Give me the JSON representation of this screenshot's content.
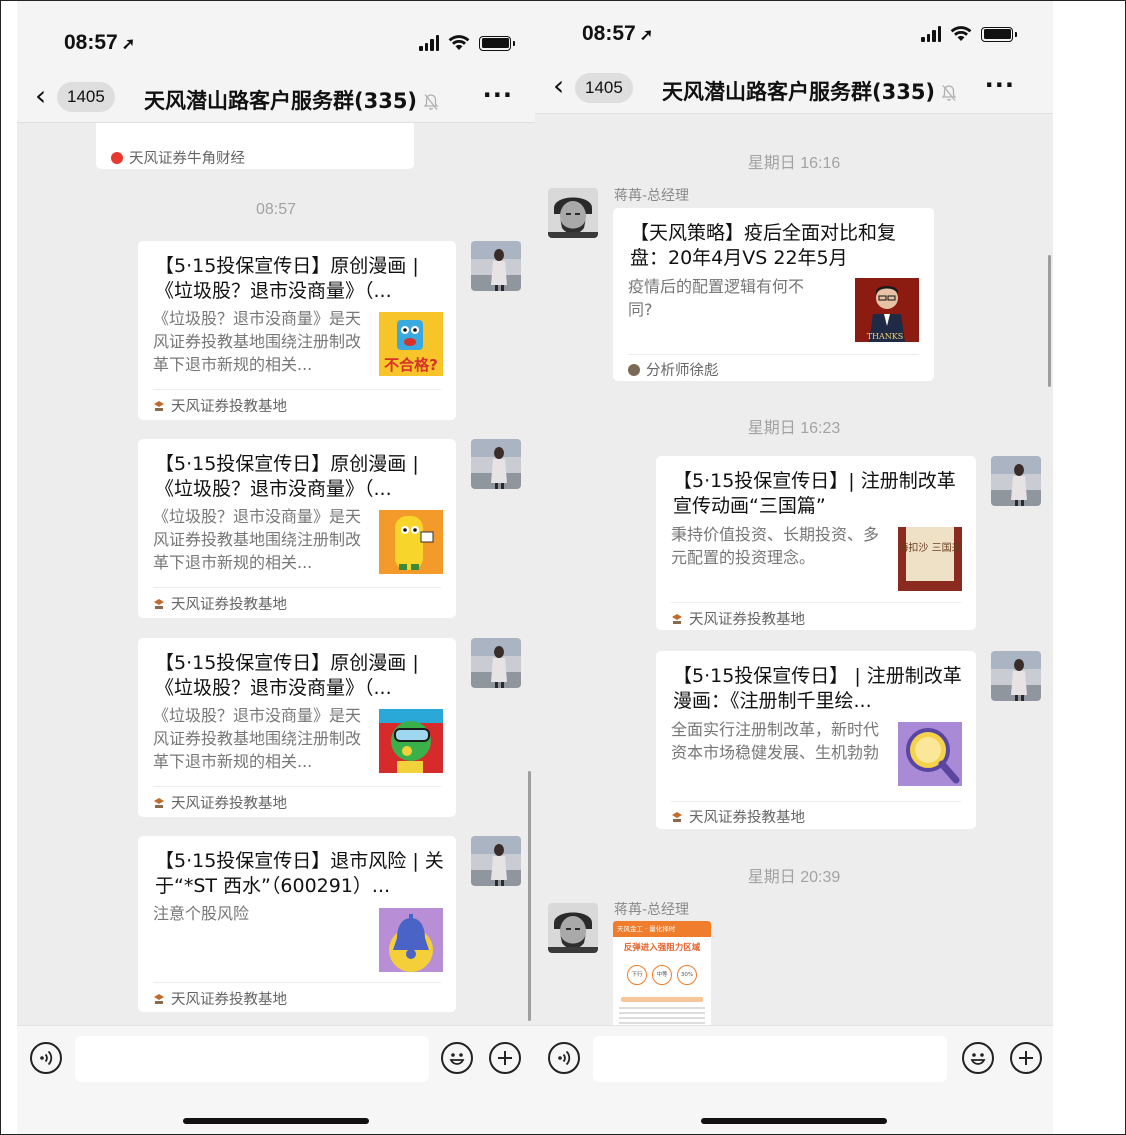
{
  "left": {
    "status": {
      "time": "08:57"
    },
    "header": {
      "unread_count": "1405",
      "title": "天风潜山路客户服务群(335)"
    },
    "partial_card_source": "天风证券牛角财经",
    "timestamp": "08:57",
    "messages": [
      {
        "title": "【5·15投保宣传日】原创漫画 |《垃圾股？退市没商量》（...",
        "description": "《垃圾股？退市没商量》是天风证券投教基地围绕注册制改革下退市新规的相关...",
        "source": "天风证券投教基地",
        "thumb_text": "不合格?"
      },
      {
        "title": "【5·15投保宣传日】原创漫画 |《垃圾股？退市没商量》（...",
        "description": "《垃圾股？退市没商量》是天风证券投教基地围绕注册制改革下退市新规的相关...",
        "source": "天风证券投教基地"
      },
      {
        "title": "【5·15投保宣传日】原创漫画 |《垃圾股？退市没商量》（...",
        "description": "《垃圾股？退市没商量》是天风证券投教基地围绕注册制改革下退市新规的相关...",
        "source": "天风证券投教基地"
      },
      {
        "title": "【5·15投保宣传日】退市风险 | 关于“*ST 西水”（600291）...",
        "description": "注意个股风险",
        "source": "天风证券投教基地"
      }
    ]
  },
  "right": {
    "status": {
      "time": "08:57"
    },
    "header": {
      "unread_count": "1405",
      "title": "天风潜山路客户服务群(335)"
    },
    "timestamps": [
      "星期日 16:16",
      "星期日 16:23",
      "星期日 20:39"
    ],
    "sender_name": "蒋苒-总经理",
    "messages": [
      {
        "title": "【天风策略】疫后全面对比和复盘：20年4月VS 22年5月",
        "description": "疫情后的配置逻辑有何不同?",
        "source": "分析师徐彪",
        "thumb_text": "THANKS"
      },
      {
        "title": "【5·15投保宣传日】| 注册制改革宣传动画“三国篇”",
        "description": "秉持价值投资、长期投资、多元配置的投资理念。",
        "source": "天风证券投教基地",
        "thumb_text": "股海扣沙 三国来登"
      },
      {
        "title": "【5·15投保宣传日】 | 注册制改革漫画：《注册制千里绘...",
        "description": "全面实行注册制改革，新时代资本市场稳健发展、生机勃勃",
        "source": "天风证券投教基地"
      }
    ],
    "poster": {
      "header": "天风金工 · 量化择时",
      "headline": "反弹进入强阻力区域",
      "dials": [
        "下行",
        "中等",
        "30%"
      ]
    }
  },
  "colors": {
    "chat_bg": "#ededed",
    "card_bg": "#ffffff",
    "timestamp": "#a3a3a3",
    "source_text": "#666666"
  }
}
